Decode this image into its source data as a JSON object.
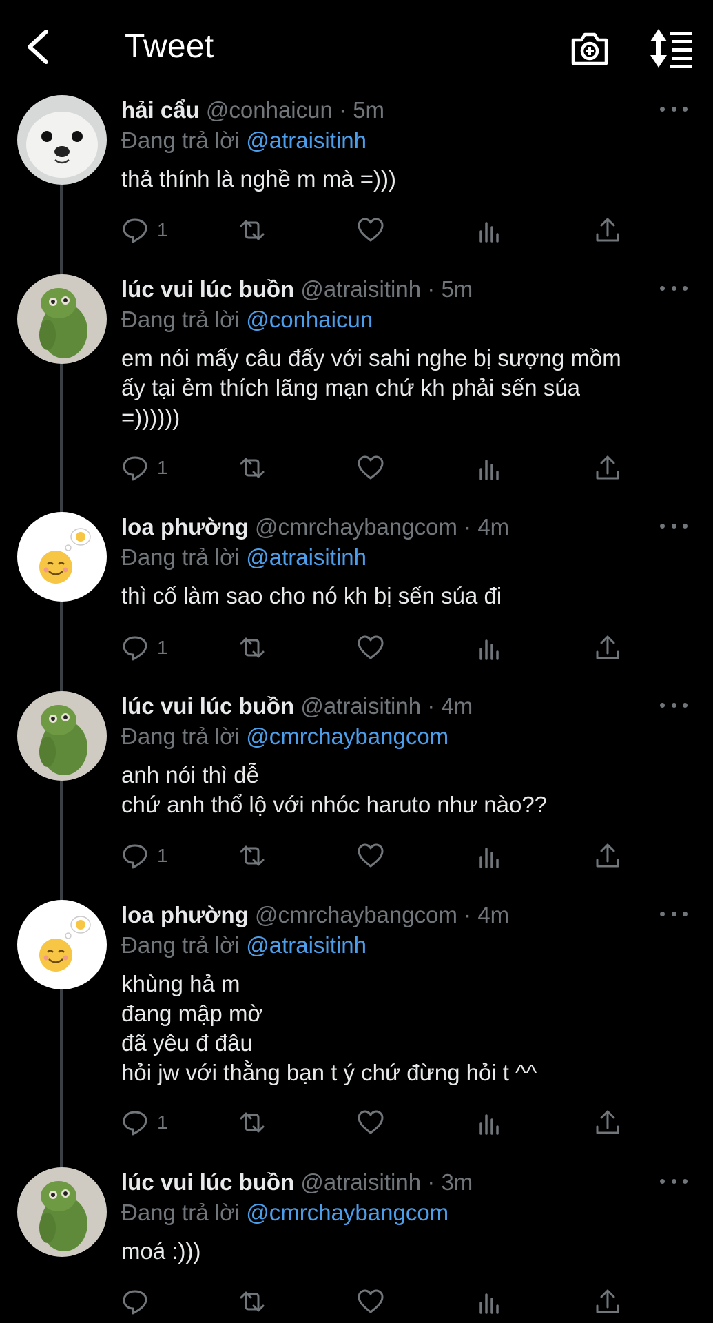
{
  "header": {
    "title": "Tweet",
    "back_icon": "back-arrow-icon",
    "camera_icon": "camera-add-icon",
    "sort_icon": "sort-list-icon"
  },
  "colors": {
    "background": "#000000",
    "text": "#e7e9ea",
    "muted": "#71767b",
    "link": "#4c9eeb",
    "thread_line": "#3a3f44"
  },
  "reply_prefix": "Đang trả lời",
  "tweets": [
    {
      "name": "hải cẩu",
      "handle": "@conhaicun",
      "dot": "·",
      "time": "5m",
      "reply_to": "@atraisitinh",
      "text": "thả thính là nghề m mà =)))",
      "reply_count": "1",
      "avatar": "seal"
    },
    {
      "name": "lúc vui lúc buồn",
      "handle": "@atraisitinh",
      "dot": "·",
      "time": "5m",
      "reply_to": "@conhaicun",
      "text": "em nói mấy câu đấy với sahi nghe bị sượng mồm\nấy tại ẻm thích lãng mạn chứ kh phải sến súa\n=))))))",
      "reply_count": "1",
      "avatar": "green-plush"
    },
    {
      "name": "loa phường",
      "handle": "@cmrchaybangcom",
      "dot": "·",
      "time": "4m",
      "reply_to": "@atraisitinh",
      "text": "thì cố làm sao cho nó kh bị sến súa đi",
      "reply_count": "1",
      "avatar": "smiley"
    },
    {
      "name": "lúc vui lúc buồn",
      "handle": "@atraisitinh",
      "dot": "·",
      "time": "4m",
      "reply_to": "@cmrchaybangcom",
      "text": "anh nói thì dễ\nchứ anh thổ lộ với nhóc haruto như nào??",
      "reply_count": "1",
      "avatar": "green-plush"
    },
    {
      "name": "loa phường",
      "handle": "@cmrchaybangcom",
      "dot": "·",
      "time": "4m",
      "reply_to": "@atraisitinh",
      "text": "khùng hả m\nđang mập mờ\nđã yêu đ đâu\nhỏi jw với thằng bạn t ý chứ đừng hỏi t ^^",
      "reply_count": "1",
      "avatar": "smiley"
    },
    {
      "name": "lúc vui lúc buồn",
      "handle": "@atraisitinh",
      "dot": "·",
      "time": "3m",
      "reply_to": "@cmrchaybangcom",
      "text": "moá :)))",
      "reply_count": "",
      "avatar": "green-plush"
    }
  ],
  "action_icons": [
    "reply-icon",
    "retweet-icon",
    "like-icon",
    "analytics-icon",
    "share-icon"
  ]
}
